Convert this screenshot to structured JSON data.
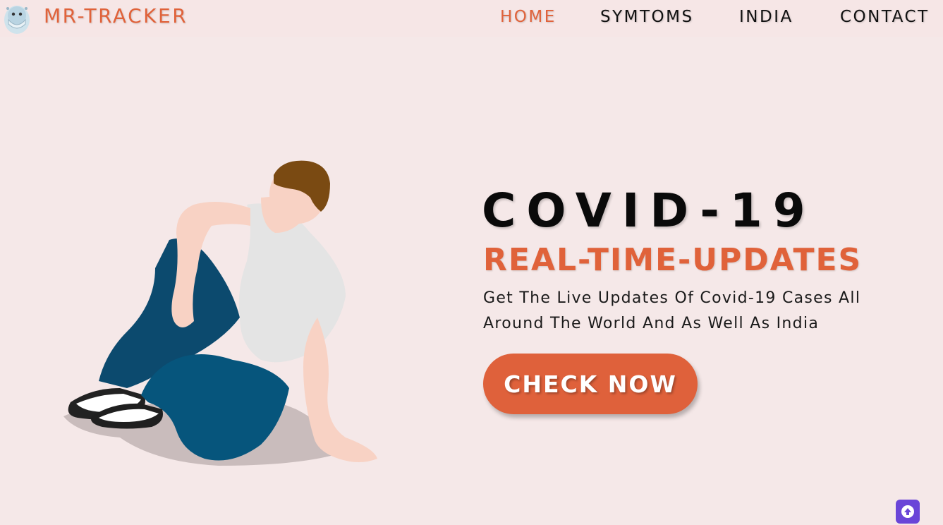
{
  "navbar": {
    "brand": "MR-TRACKER",
    "logo_icon": "mask-virus-logo-icon",
    "links": [
      {
        "label": "HOME",
        "active": true
      },
      {
        "label": "SYMTOMS",
        "active": false
      },
      {
        "label": "INDIA",
        "active": false
      },
      {
        "label": "CONTACT",
        "active": false
      }
    ]
  },
  "hero": {
    "title": "COVID-19",
    "subtitle": "REAL-TIME-UPDATES",
    "description_line1": "Get The Live Updates Of Covid-19 Cases All",
    "description_line2": "Around The World And As Well As India",
    "cta_label": "CHECK NOW",
    "illustration": "sitting-man-illustration"
  },
  "scroll_top_icon": "arrow-up-circle-icon",
  "colors": {
    "background": "#f5e8e8",
    "accent": "#e0623a",
    "text": "#0a0a0a",
    "scroll_button": "#6a45d8"
  }
}
